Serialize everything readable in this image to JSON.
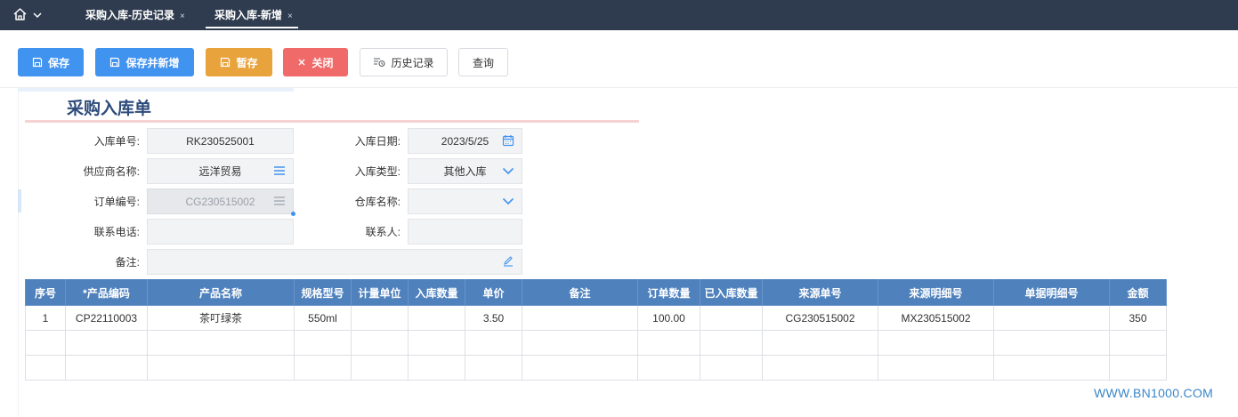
{
  "tabs": [
    {
      "label": "采购入库-历史记录",
      "close": "×"
    },
    {
      "label": "采购入库-新增",
      "close": "×"
    }
  ],
  "toolbar": {
    "save": "保存",
    "save_new": "保存并新增",
    "draft": "暂存",
    "close": "关闭",
    "history": "历史记录",
    "query": "查询"
  },
  "form": {
    "title": "采购入库单",
    "labels": {
      "receipt_no": "入库单号:",
      "receipt_date": "入库日期:",
      "supplier": "供应商名称:",
      "receipt_type": "入库类型:",
      "order_no": "订单编号:",
      "warehouse": "仓库名称:",
      "phone": "联系电话:",
      "contact": "联系人:",
      "remark": "备注:"
    },
    "values": {
      "receipt_no": "RK230525001",
      "receipt_date": "2023/5/25",
      "supplier": "远洋贸易",
      "receipt_type": "其他入库",
      "order_no": "CG230515002",
      "warehouse": "",
      "phone": "",
      "contact": "",
      "remark": ""
    }
  },
  "table": {
    "columns": [
      "序号",
      "*产品编码",
      "产品名称",
      "规格型号",
      "计量单位",
      "入库数量",
      "单价",
      "备注",
      "订单数量",
      "已入库数量",
      "来源单号",
      "来源明细号",
      "单据明细号",
      "金额"
    ],
    "rows": [
      [
        "1",
        "CP22110003",
        "茶叮绿茶",
        "550ml",
        "",
        "",
        "3.50",
        "",
        "100.00",
        "",
        "CG230515002",
        "MX230515002",
        "",
        "350"
      ],
      [
        "",
        "",
        "",
        "",
        "",
        "",
        "",
        "",
        "",
        "",
        "",
        "",
        "",
        ""
      ],
      [
        "",
        "",
        "",
        "",
        "",
        "",
        "",
        "",
        "",
        "",
        "",
        "",
        "",
        ""
      ]
    ]
  },
  "watermark": "WWW.BN1000.COM",
  "colors": {
    "topbar": "#2f3b4e",
    "primary": "#4193f0",
    "warning": "#e9a33d",
    "danger": "#f06a6a",
    "table_header": "#4f81bd",
    "title": "#2d4b7a"
  },
  "icons": [
    "home-icon",
    "chevron-down-icon",
    "save-icon",
    "close-icon",
    "history-icon",
    "calendar-icon",
    "list-icon",
    "edit-icon"
  ]
}
